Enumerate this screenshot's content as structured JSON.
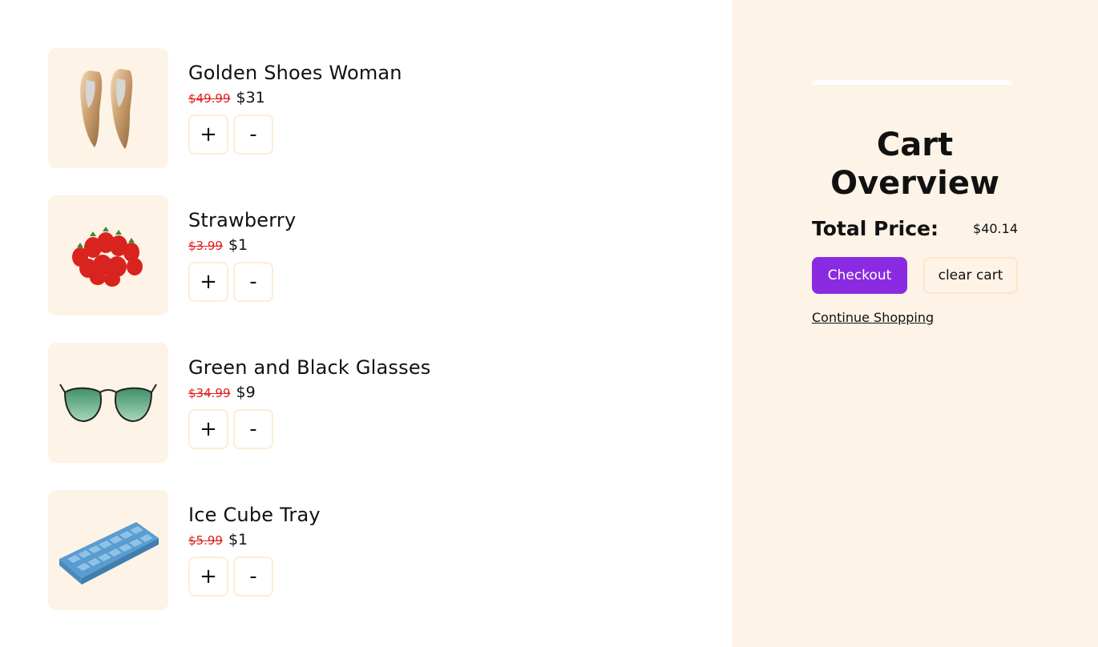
{
  "cart": {
    "items": [
      {
        "name": "Golden Shoes Woman",
        "old_price": "$49.99",
        "new_price": "$31",
        "image": "golden-shoes-image"
      },
      {
        "name": "Strawberry",
        "old_price": "$3.99",
        "new_price": "$1",
        "image": "strawberry-image"
      },
      {
        "name": "Green and Black Glasses",
        "old_price": "$34.99",
        "new_price": "$9",
        "image": "glasses-image"
      },
      {
        "name": "Ice Cube Tray",
        "old_price": "$5.99",
        "new_price": "$1",
        "image": "ice-cube-tray-image"
      }
    ],
    "increment_label": "+",
    "decrement_label": "-"
  },
  "overview": {
    "title": "Cart Overview",
    "total_label": "Total Price:",
    "total_value": "$40.14",
    "checkout_label": "Checkout",
    "clear_label": "clear cart",
    "continue_label": "Continue Shopping"
  },
  "colors": {
    "accent": "#8a2be2",
    "panel": "#fdf3e6",
    "old_price": "#e11d1d"
  }
}
